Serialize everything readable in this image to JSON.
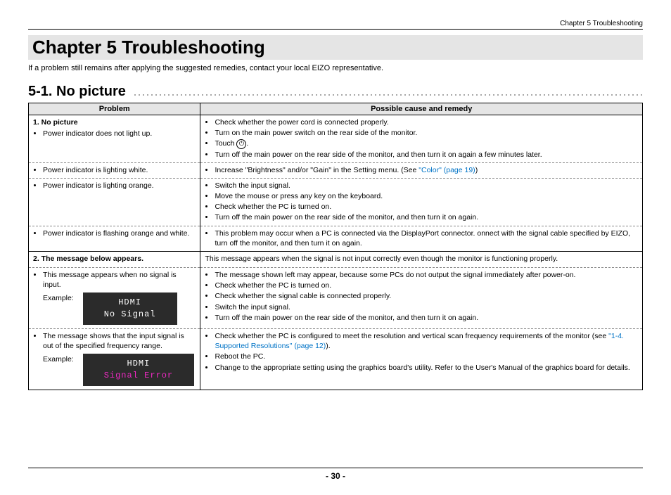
{
  "header_crumb": "Chapter 5   Troubleshooting",
  "chapter_title": "Chapter 5  Troubleshooting",
  "intro": "If a problem still remains after applying the suggested remedies, contact your local EIZO representative.",
  "section_title": "5-1.  No picture",
  "table": {
    "headers": {
      "problem": "Problem",
      "remedy": "Possible cause and remedy"
    },
    "row1": {
      "heading": "1.  No picture",
      "bullet": "Power indicator does not light up.",
      "r1": "Check whether the power cord is connected properly.",
      "r2": "Turn on the main power switch on the rear side of the monitor.",
      "r3": "Touch ",
      "r4": "Turn off the main power on the rear side of the monitor, and then turn it on again a few minutes later."
    },
    "row2": {
      "bullet": "Power indicator is lighting white.",
      "r1a": "Increase \"Brightness\" and/or \"Gain\" in the Setting menu. (See ",
      "r1link": "\"Color\" (page 19)",
      "r1b": ")"
    },
    "row3": {
      "bullet": "Power indicator is lighting orange.",
      "r1": "Switch the input signal.",
      "r2": "Move the mouse or press any key on the keyboard.",
      "r3": "Check whether the PC is turned on.",
      "r4": "Turn off the main power on the rear side of the monitor, and then turn it on again."
    },
    "row4": {
      "bullet": "Power indicator is flashing orange and white.",
      "r1": "This problem may occur when a PC is connected via the DisplayPort connector. onnect with the signal cable specified by EIZO, turn off the monitor, and then turn it on again."
    },
    "row5": {
      "heading": "2.  The message below appears.",
      "remedy": "This message appears when the signal is not input correctly even though the monitor is functioning properly."
    },
    "row6": {
      "bullet": "This message appears when no signal is input.",
      "example_label": "Example:",
      "screen_l1": "HDMI",
      "screen_l2": "No Signal",
      "r1": "The message shown left may appear, because some PCs do not output the signal immediately after power-on.",
      "r2": "Check whether the PC is turned on.",
      "r3": "Check whether the signal cable is connected properly.",
      "r4": "Switch the input signal.",
      "r5": "Turn off the main power on the rear side of the monitor, and then turn it on again."
    },
    "row7": {
      "bullet": "The message shows that the input signal is out of the specified frequency range.",
      "example_label": "Example:",
      "screen_l1": "HDMI",
      "screen_l2": "Signal Error",
      "r1a": "Check whether the PC is configured to meet the resolution and vertical scan frequency requirements of the monitor (see ",
      "r1link": "\"1-4. Supported Resolutions\" (page 12)",
      "r1b": ").",
      "r2": "Reboot the PC.",
      "r3": "Change to the appropriate setting using the graphics board's utility. Refer to the User's Manual of the graphics board for details."
    }
  },
  "page_number": "- 30 -"
}
